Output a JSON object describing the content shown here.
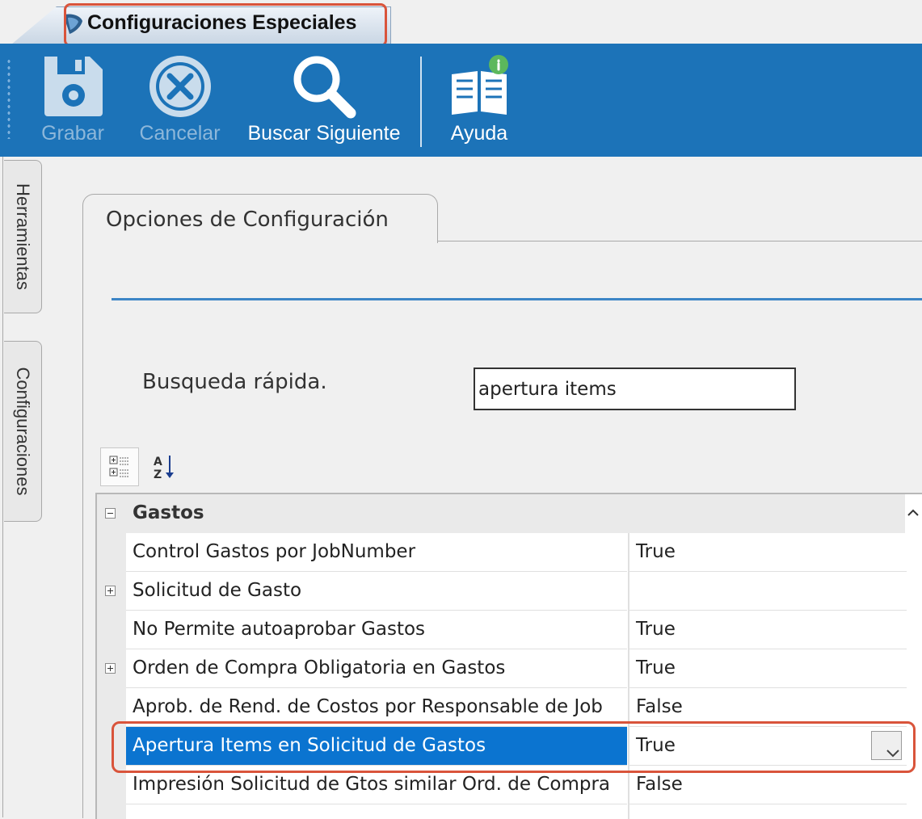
{
  "window": {
    "tab_title": "Configuraciones Especiales"
  },
  "ribbon": {
    "save_label": "Grabar",
    "cancel_label": "Cancelar",
    "search_next_label": "Buscar Siguiente",
    "help_label": "Ayuda"
  },
  "side_tabs": [
    "Herramientas",
    "Configuraciones"
  ],
  "panel": {
    "tab_label": "Opciones de Configuración",
    "quick_search_label": "Busqueda rápida.",
    "quick_search_value": "apertura items"
  },
  "grid": {
    "category": "Gastos",
    "rows": [
      {
        "name": "Control Gastos por JobNumber",
        "value": "True"
      },
      {
        "name": "Solicitud de Gasto",
        "value": ""
      },
      {
        "name": "No Permite autoaprobar Gastos",
        "value": "True"
      },
      {
        "name": "Orden de Compra Obligatoria en Gastos",
        "value": "True"
      },
      {
        "name": "Aprob. de Rend. de Costos por Responsable de Job",
        "value": "False"
      },
      {
        "name": "Apertura Items en Solicitud de Gastos",
        "value": "True"
      },
      {
        "name": "Impresión Solicitud de Gtos similar Ord. de Compra",
        "value": "False"
      }
    ]
  },
  "colors": {
    "ribbon": "#1c73b8",
    "selection": "#0b74d0",
    "highlight": "#d9543b"
  }
}
